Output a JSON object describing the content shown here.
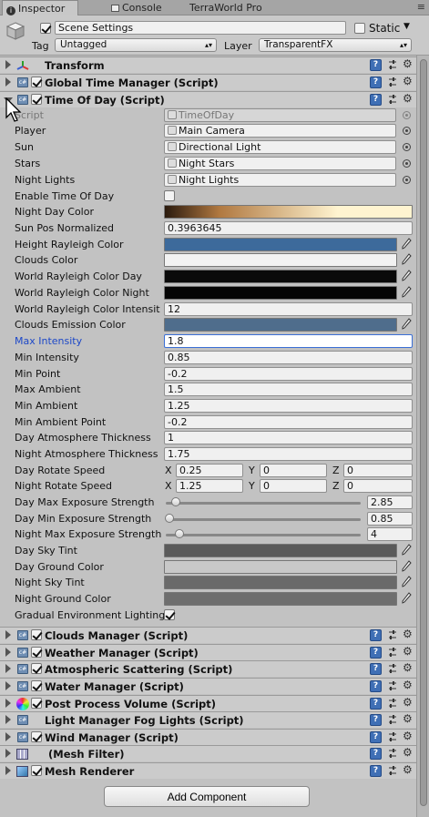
{
  "tabs": [
    {
      "label": "Inspector",
      "active": true,
      "icon": "info-icon"
    },
    {
      "label": "Console",
      "active": false,
      "icon": "console-icon"
    },
    {
      "label": "TerraWorld Pro",
      "active": false
    }
  ],
  "header": {
    "object_name": "Scene Settings",
    "static_label": "Static",
    "tag_label": "Tag",
    "tag_value": "Untagged",
    "layer_label": "Layer",
    "layer_value": "TransparentFX"
  },
  "components_top": [
    {
      "title": "Transform",
      "has_checkbox": false,
      "icon": "transform-icon"
    },
    {
      "title": "Global Time Manager (Script)",
      "has_checkbox": true,
      "icon": "script-icon"
    },
    {
      "title": "Time Of Day (Script)",
      "has_checkbox": true,
      "icon": "script-icon",
      "expanded": true
    }
  ],
  "time_of_day": {
    "script_label": "Script",
    "script_value": "TimeOfDay",
    "player_label": "Player",
    "player_value": "Main Camera",
    "sun_label": "Sun",
    "sun_value": "Directional Light",
    "stars_label": "Stars",
    "stars_value": "Night Stars",
    "night_lights_label": "Night Lights",
    "night_lights_value": "Night Lights",
    "enable_label": "Enable Time Of Day",
    "enable_checked": false,
    "night_day_color_label": "Night Day Color",
    "sun_pos_label": "Sun Pos Normalized",
    "sun_pos_value": "0.3963645",
    "height_rayleigh_label": "Height Rayleigh Color",
    "height_rayleigh_color": "#3d6a9b",
    "clouds_color_label": "Clouds Color",
    "clouds_color": "#f2f2f2",
    "world_day_label": "World Rayleigh Color Day",
    "world_day_color": "#0a0a0a",
    "world_night_label": "World Rayleigh Color Night",
    "world_night_color": "#050505",
    "world_intensity_label": "World Rayleigh Color Intensit",
    "world_intensity_value": "12",
    "clouds_emission_label": "Clouds Emission Color",
    "clouds_emission_color": "#4f6d8c",
    "max_intensity_label": "Max Intensity",
    "max_intensity_value": "1.8",
    "min_intensity_label": "Min Intensity",
    "min_intensity_value": "0.85",
    "min_point_label": "Min Point",
    "min_point_value": "-0.2",
    "max_ambient_label": "Max Ambient",
    "max_ambient_value": "1.5",
    "min_ambient_label": "Min Ambient",
    "min_ambient_value": "1.25",
    "min_ambient_point_label": "Min Ambient Point",
    "min_ambient_point_value": "-0.2",
    "day_atmo_label": "Day Atmosphere Thickness",
    "day_atmo_value": "1",
    "night_atmo_label": "Night Atmosphere Thickness",
    "night_atmo_value": "1.75",
    "day_rotate_label": "Day Rotate Speed",
    "day_rotate": {
      "x": "0.25",
      "y": "0",
      "z": "0"
    },
    "night_rotate_label": "Night Rotate Speed",
    "night_rotate": {
      "x": "1.25",
      "y": "0",
      "z": "0"
    },
    "axis_x": "X",
    "axis_y": "Y",
    "axis_z": "Z",
    "day_max_exp_label": "Day Max Exposure Strength",
    "day_max_exp_value": "2.85",
    "day_max_exp_fraction": 0.05,
    "day_min_exp_label": "Day Min Exposure Strength",
    "day_min_exp_value": "0.85",
    "day_min_exp_fraction": 0.02,
    "night_max_exp_label": "Night Max Exposure Strength",
    "night_max_exp_value": "4",
    "night_max_exp_fraction": 0.07,
    "day_sky_tint_label": "Day Sky Tint",
    "day_sky_tint_color": "#5a5a5a",
    "day_ground_label": "Day Ground Color",
    "day_ground_color": "#c8c8c8",
    "night_sky_tint_label": "Night Sky Tint",
    "night_sky_tint_color": "#6a6a6a",
    "night_ground_label": "Night Ground Color",
    "night_ground_color": "#6e6e6e",
    "gradual_label": "Gradual Environment Lighting",
    "gradual_checked": true
  },
  "components_bottom": [
    {
      "title": "Clouds Manager (Script)",
      "has_checkbox": true,
      "icon": "script-icon"
    },
    {
      "title": "Weather Manager (Script)",
      "has_checkbox": true,
      "icon": "script-icon"
    },
    {
      "title": "Atmospheric Scattering (Script)",
      "has_checkbox": true,
      "icon": "script-icon"
    },
    {
      "title": "Water Manager (Script)",
      "has_checkbox": true,
      "icon": "script-icon"
    },
    {
      "title": "Post Process Volume (Script)",
      "has_checkbox": true,
      "icon": "color-wheel-icon"
    },
    {
      "title": "Light Manager Fog Lights (Script)",
      "has_checkbox": false,
      "icon": "script-icon"
    },
    {
      "title": "Wind Manager (Script)",
      "has_checkbox": true,
      "icon": "script-icon"
    },
    {
      "title": "(Mesh Filter)",
      "has_checkbox": false,
      "icon": "mesh-filter-icon"
    },
    {
      "title": "Mesh Renderer",
      "has_checkbox": true,
      "icon": "mesh-renderer-icon"
    }
  ],
  "add_component_label": "Add Component",
  "colors": {
    "panel_bg": "#c2c2c2",
    "help_blue": "#3f6fb5",
    "focused_label": "#1d48c8",
    "gradient_start": "#2a1a0e",
    "gradient_mid": "#b07840",
    "gradient_end": "#fff4d0"
  }
}
